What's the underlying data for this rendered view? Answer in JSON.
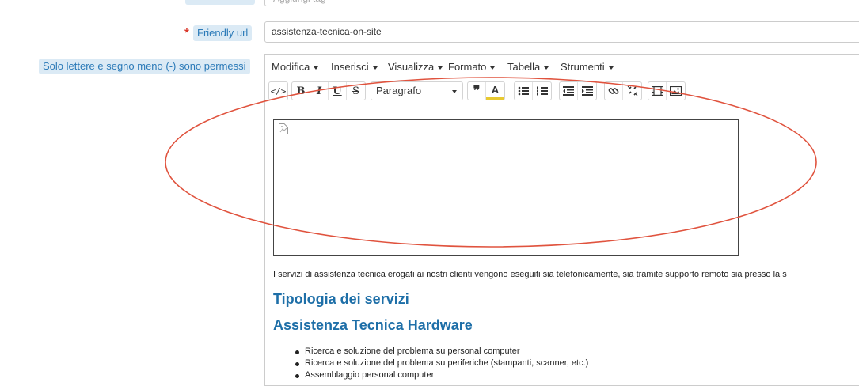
{
  "top_field": {
    "placeholder_partial": "Aggiungi tag"
  },
  "friendly_url": {
    "required_mark": "*",
    "label": "Friendly url",
    "value": "assistenza-tecnica-on-site"
  },
  "hint": "Solo lettere e segno meno (-) sono permessi",
  "editor": {
    "menu": [
      "Modifica",
      "Inserisci",
      "Visualizza",
      "Formato",
      "Tabella",
      "Strumenti"
    ],
    "format_select": "Paragrafo",
    "toolbar_icons": [
      "source-code-icon",
      "bold-icon",
      "italic-icon",
      "underline-icon",
      "strikethrough-icon",
      "blockquote-icon",
      "text-color-icon",
      "bullet-list-icon",
      "numbered-list-icon",
      "outdent-icon",
      "indent-icon",
      "link-icon",
      "unlink-icon",
      "media-icon",
      "image-icon"
    ],
    "content": {
      "paragraph": "I servizi di assistenza tecnica erogati ai nostri clienti vengono eseguiti sia telefonicamente, sia tramite supporto remoto sia presso la s",
      "heading1": "Tipologia dei servizi",
      "heading2": "Assistenza Tecnica Hardware",
      "bullets": [
        "Ricerca e soluzione del problema su personal computer",
        "Ricerca e soluzione del problema su periferiche (stampanti, scanner, etc.)",
        "Assemblaggio personal computer"
      ]
    }
  },
  "colors": {
    "label_bg": "#dbeaf5",
    "label_text": "#2b7ab8",
    "heading": "#1e6fa8",
    "required": "#d9372a",
    "annotation": "#e0533e"
  }
}
